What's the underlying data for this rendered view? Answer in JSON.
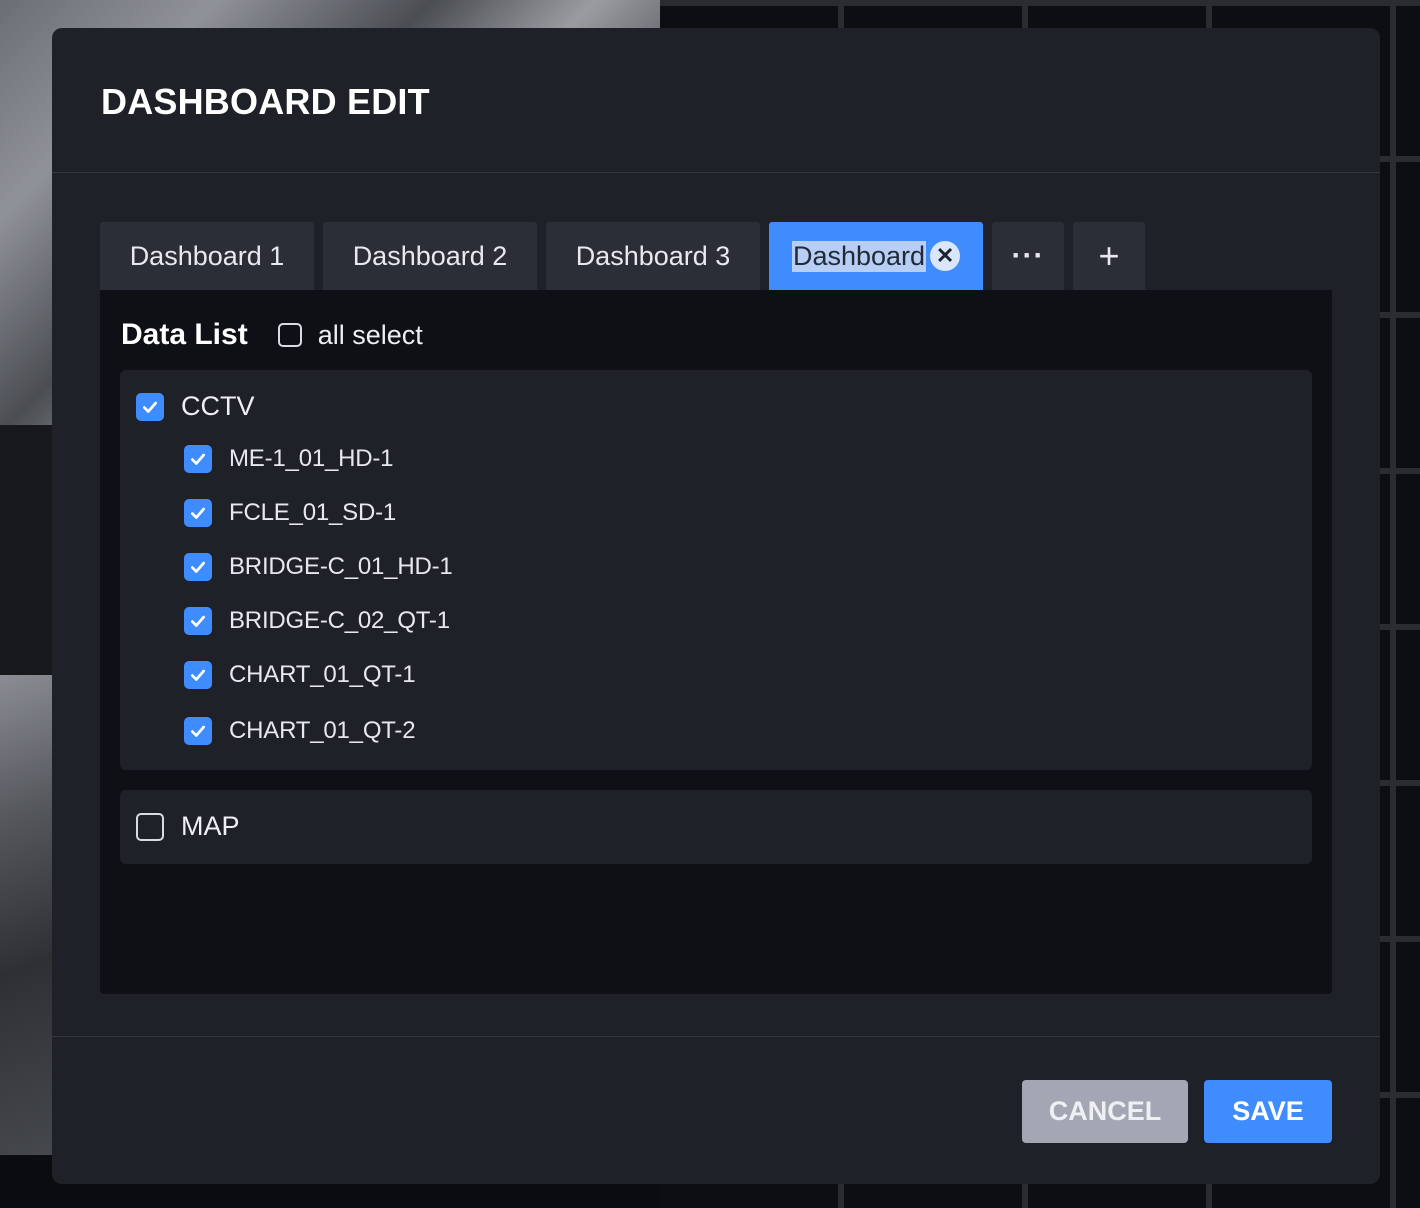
{
  "modal": {
    "title": "DASHBOARD EDIT"
  },
  "tabs": [
    {
      "label": "Dashboard 1"
    },
    {
      "label": "Dashboard 2"
    },
    {
      "label": "Dashboard 3"
    },
    {
      "label": "Dashboard",
      "active": true,
      "editing": true
    }
  ],
  "tab_more": {
    "label": "···",
    "icon": "more-horizontal-icon"
  },
  "tab_add": {
    "label": "+",
    "icon": "plus-icon"
  },
  "tab_close_icon": "close-circle-icon",
  "panel": {
    "title": "Data List",
    "all_select_label": "all select",
    "all_select_checked": false
  },
  "groups": [
    {
      "label": "CCTV",
      "checked": true,
      "items": [
        {
          "label": "ME-1_01_HD-1",
          "checked": true
        },
        {
          "label": "FCLE_01_SD-1",
          "checked": true
        },
        {
          "label": "BRIDGE-C_01_HD-1",
          "checked": true
        },
        {
          "label": "BRIDGE-C_02_QT-1",
          "checked": true
        },
        {
          "label": "CHART_01_QT-1",
          "checked": true
        },
        {
          "label": "CHART_01_QT-2",
          "checked": true
        }
      ]
    },
    {
      "label": "MAP",
      "checked": false,
      "items": []
    }
  ],
  "footer": {
    "cancel_label": "CANCEL",
    "save_label": "SAVE"
  },
  "colors": {
    "accent": "#3f8cff",
    "modal_bg": "#1f2128",
    "panel_bg": "#0e1016",
    "cancel_bg": "#a3a7b3"
  }
}
